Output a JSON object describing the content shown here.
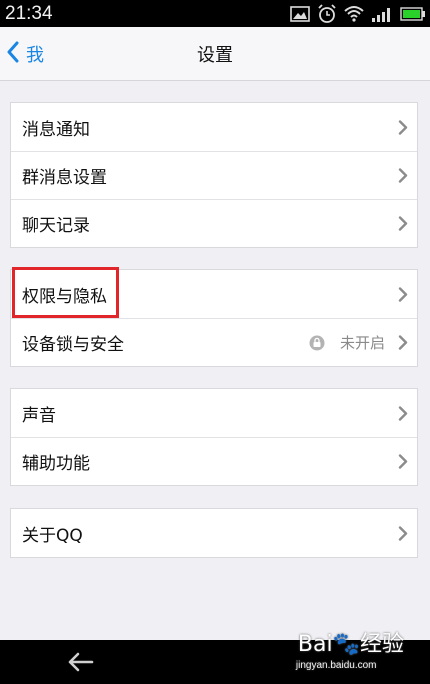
{
  "status_bar": {
    "time": "21:34",
    "icons": [
      "image-icon",
      "alarm-icon",
      "wifi-icon",
      "signal-icon",
      "battery-icon"
    ]
  },
  "nav": {
    "back_label": "我",
    "title": "设置"
  },
  "groups": [
    {
      "items": [
        {
          "label": "消息通知"
        },
        {
          "label": "群消息设置"
        },
        {
          "label": "聊天记录"
        }
      ]
    },
    {
      "items": [
        {
          "label": "权限与隐私",
          "highlighted": true
        },
        {
          "label": "设备锁与安全",
          "value": "未开启",
          "icon": "lock-icon"
        }
      ]
    },
    {
      "items": [
        {
          "label": "声音"
        },
        {
          "label": "辅助功能"
        }
      ]
    },
    {
      "items": [
        {
          "label": "关于QQ"
        }
      ]
    }
  ],
  "watermark": {
    "title": "Bai🐾经验",
    "subtitle": "jingyan.baidu.com"
  },
  "colors": {
    "accent": "#1a86e3",
    "highlight": "#e0262a",
    "background": "#efeff4"
  }
}
